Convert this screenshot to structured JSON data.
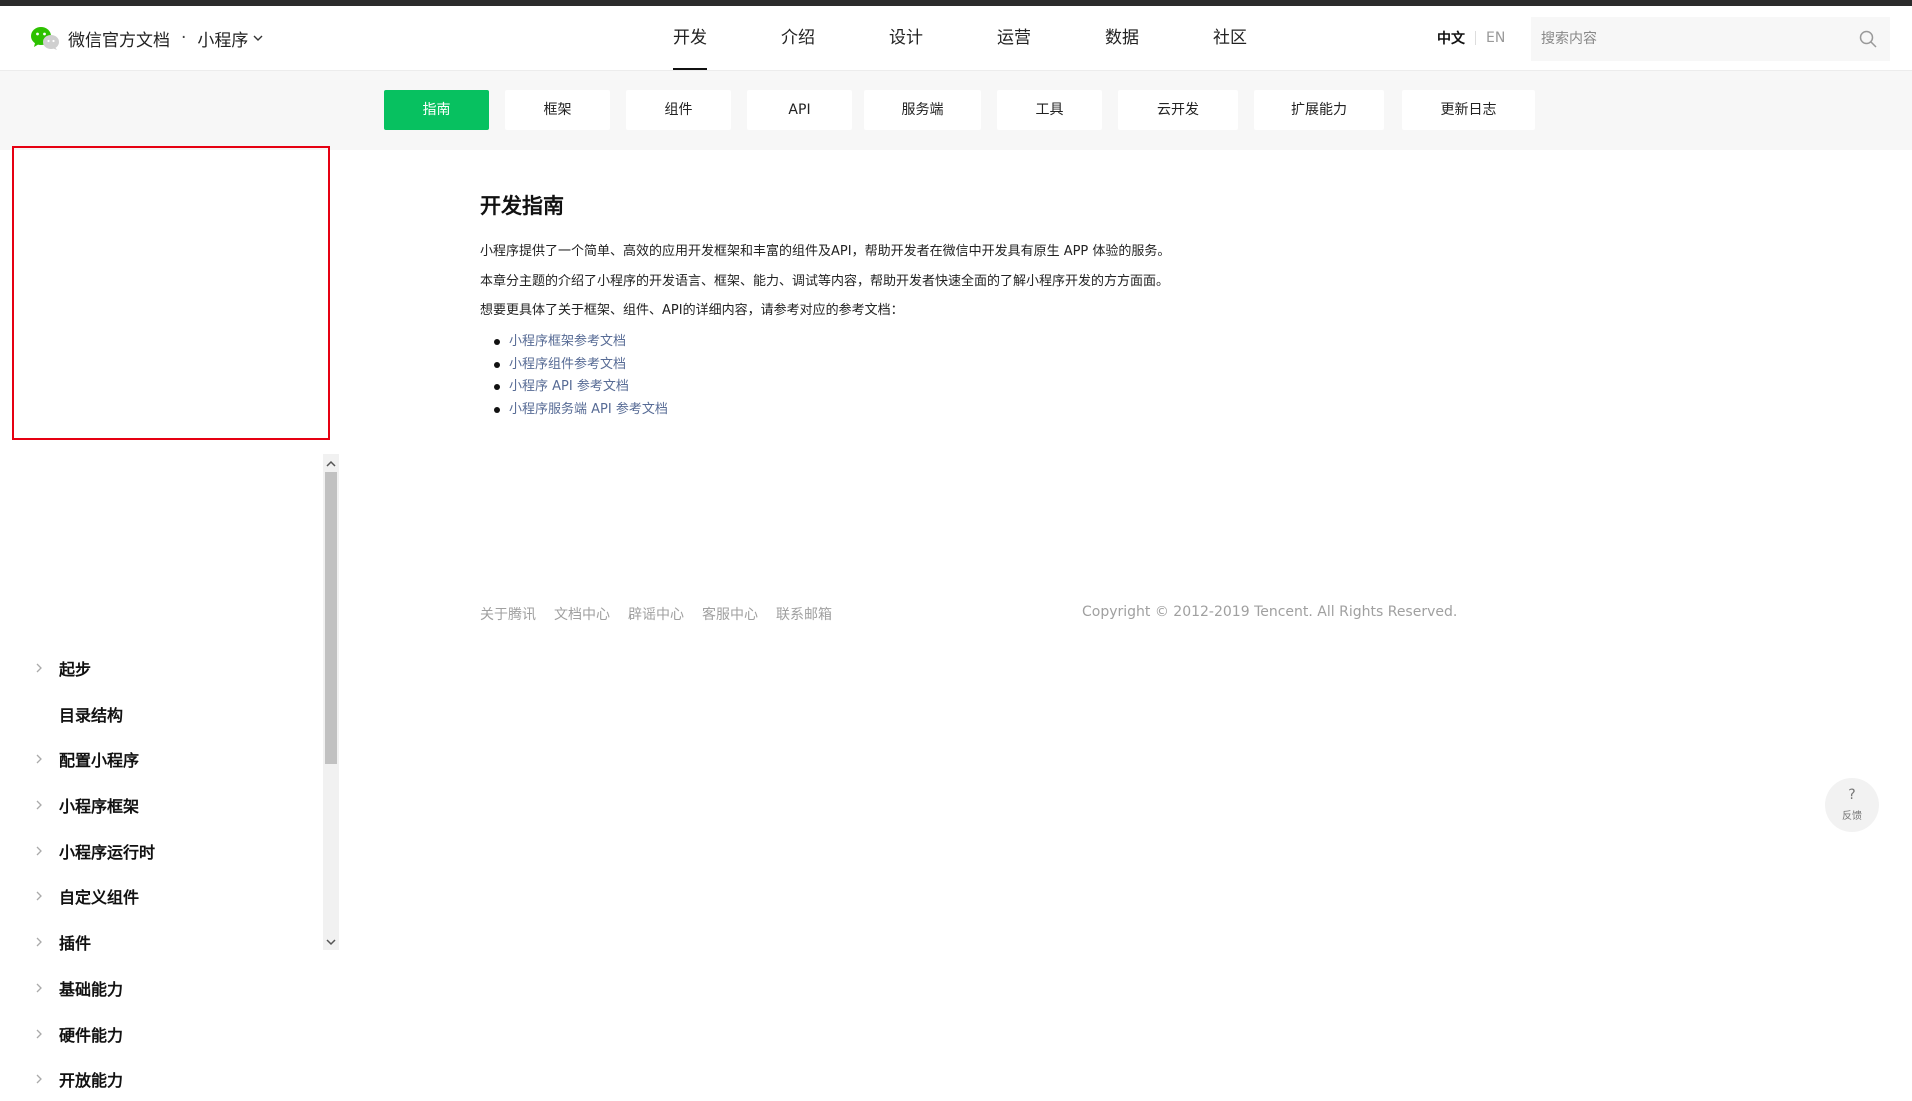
{
  "header": {
    "brand_title": "微信官方文档",
    "brand_separator": "·",
    "brand_sub": "小程序",
    "nav": [
      {
        "label": "开发",
        "active": true
      },
      {
        "label": "介绍"
      },
      {
        "label": "设计"
      },
      {
        "label": "运营"
      },
      {
        "label": "数据"
      },
      {
        "label": "社区"
      }
    ],
    "lang_zh": "中文",
    "lang_en": "EN",
    "search_placeholder": "搜索内容"
  },
  "subnav": [
    {
      "label": "指南",
      "active": true
    },
    {
      "label": "框架"
    },
    {
      "label": "组件"
    },
    {
      "label": "API"
    },
    {
      "label": "服务端"
    },
    {
      "label": "工具"
    },
    {
      "label": "云开发"
    },
    {
      "label": "扩展能力"
    },
    {
      "label": "更新日志"
    }
  ],
  "sidebar": {
    "items": [
      {
        "label": "起步",
        "expandable": true
      },
      {
        "label": "目录结构",
        "expandable": false
      },
      {
        "label": "配置小程序",
        "expandable": true
      },
      {
        "label": "小程序框架",
        "expandable": true
      },
      {
        "label": "小程序运行时",
        "expandable": true
      },
      {
        "label": "自定义组件",
        "expandable": true
      },
      {
        "label": "插件",
        "expandable": true
      },
      {
        "label": "基础能力",
        "expandable": true
      },
      {
        "label": "硬件能力",
        "expandable": true
      },
      {
        "label": "开放能力",
        "expandable": true
      }
    ]
  },
  "content": {
    "title": "开发指南",
    "paragraphs": [
      "小程序提供了一个简单、高效的应用开发框架和丰富的组件及API，帮助开发者在微信中开发具有原生 APP 体验的服务。",
      "本章分主题的介绍了小程序的开发语言、框架、能力、调试等内容，帮助开发者快速全面的了解小程序开发的方方面面。",
      "想要更具体了关于框架、组件、API的详细内容，请参考对应的参考文档："
    ],
    "links": [
      "小程序框架参考文档",
      "小程序组件参考文档",
      "小程序 API 参考文档",
      "小程序服务端 API 参考文档"
    ]
  },
  "footer": {
    "links": [
      "关于腾讯",
      "文档中心",
      "辟谣中心",
      "客服中心",
      "联系邮箱"
    ],
    "copyright": "Copyright © 2012-2019 Tencent. All Rights Reserved."
  },
  "feedback": {
    "icon": "?",
    "label": "反馈"
  },
  "colors": {
    "accent": "#07c160",
    "link": "#576b95",
    "highlight_box": "#e60012"
  }
}
